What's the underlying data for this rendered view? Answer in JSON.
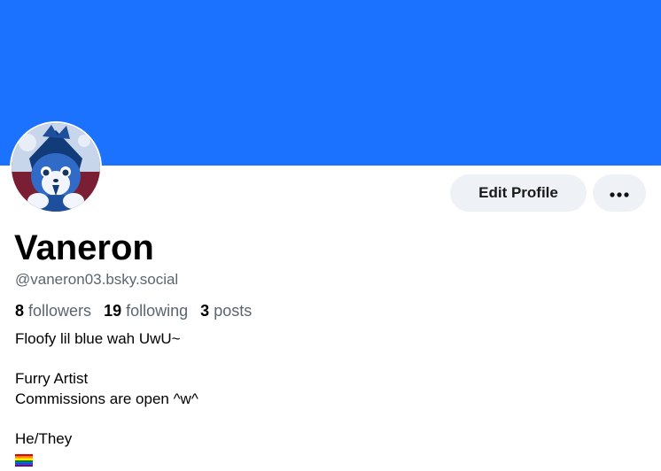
{
  "colors": {
    "banner": "#1a72ff",
    "button_bg": "#eef1f5",
    "handle_text": "#5b6570"
  },
  "profile": {
    "display_name": "Vaneron",
    "handle": "@vaneron03.bsky.social",
    "avatar_icon": "furry-avatar"
  },
  "actions": {
    "edit_label": "Edit Profile",
    "more_icon": "ellipsis-icon"
  },
  "stats": {
    "followers_count": "8",
    "followers_label": "followers",
    "following_count": "19",
    "following_label": "following",
    "posts_count": "3",
    "posts_label": "posts"
  },
  "bio": {
    "line1": "Floofy lil blue wah UwU~",
    "line2": "",
    "line3": "Furry Artist",
    "line4": "Commissions are open ^w^",
    "line5": "",
    "line6": "He/They",
    "line7_icon": "rainbow-flag-icon"
  }
}
